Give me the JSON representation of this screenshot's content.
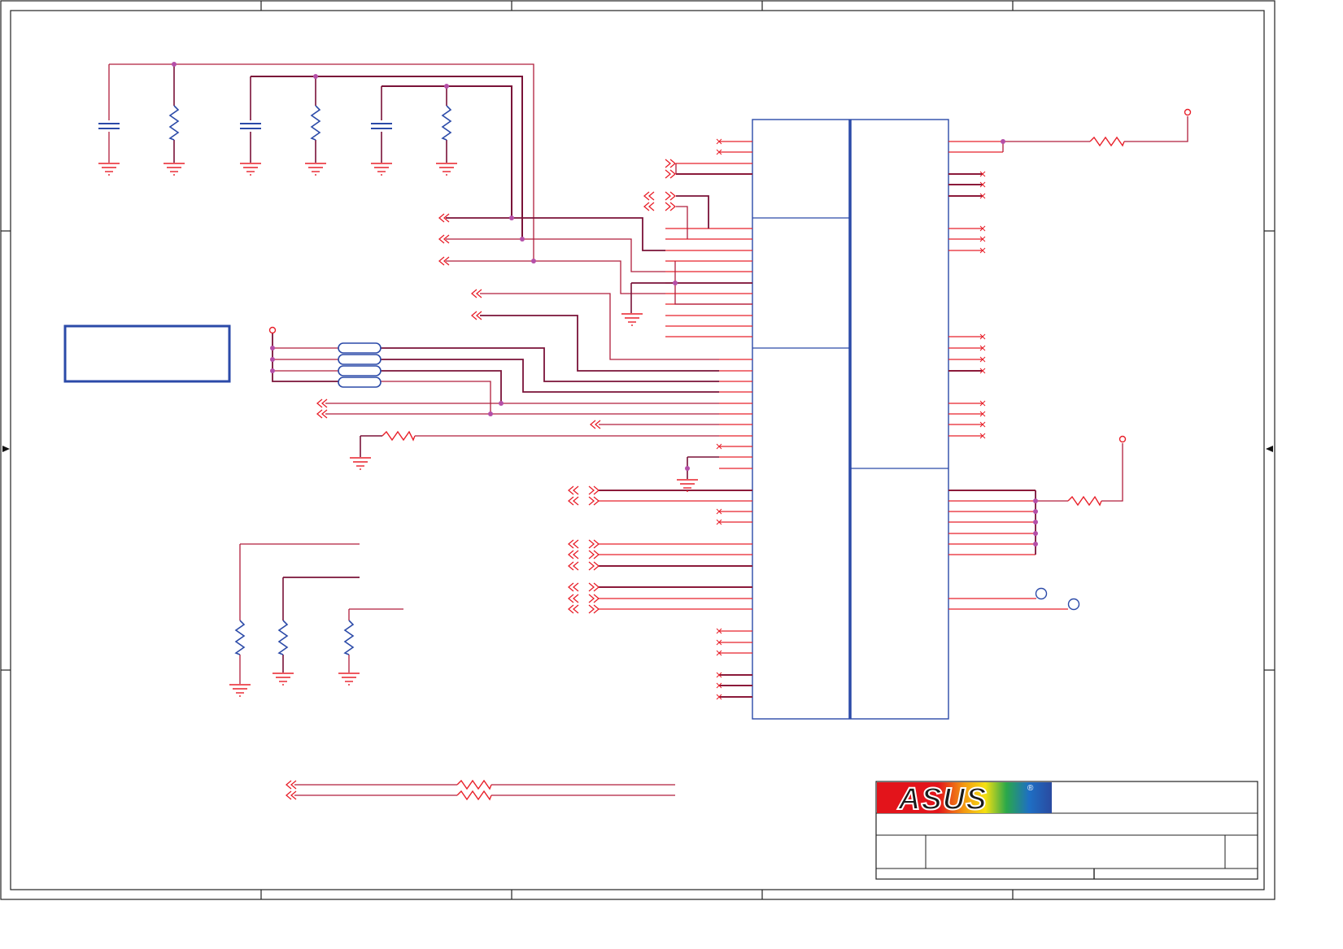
{
  "title_block": {
    "logo_text": "ASUS",
    "registered_mark": "®"
  },
  "colors": {
    "net": "#e8202a",
    "bus": "#8b1a3a",
    "component": "#2b4aa8",
    "junction": "#b54fa8",
    "frame": "#222222"
  },
  "icons": {
    "ground": "ground-icon",
    "resistor": "resistor-icon",
    "capacitor": "capacitor-icon",
    "port_arrow": "off-page-connector-icon",
    "no_connect": "no-connect-icon",
    "power_pin": "power-pin-icon",
    "test_point": "test-point-icon"
  }
}
